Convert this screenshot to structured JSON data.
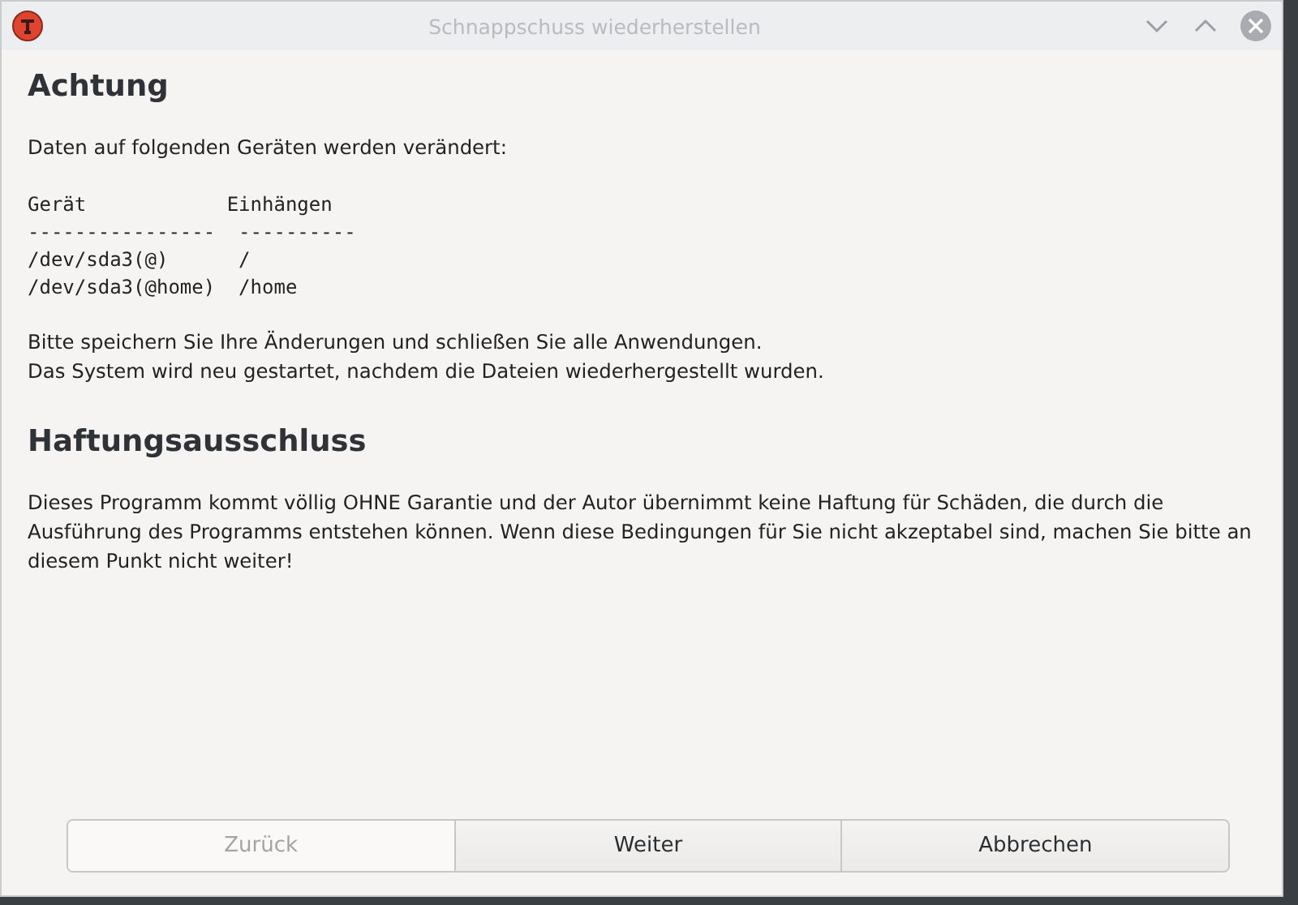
{
  "window": {
    "title": "Schnappschuss wiederherstellen"
  },
  "sections": [
    {
      "heading": "Achtung",
      "blocks": [
        {
          "kind": "text",
          "lines": [
            "Daten auf folgenden Geräten werden verändert:"
          ]
        },
        {
          "kind": "mono",
          "lines": [
            "Gerät            Einhängen",
            "----------------  ----------",
            "/dev/sda3(@)      /",
            "/dev/sda3(@home)  /home"
          ]
        },
        {
          "kind": "text",
          "lines": [
            "Bitte speichern Sie Ihre Änderungen und schließen Sie alle Anwendungen.",
            "Das System wird neu gestartet, nachdem die Dateien wiederhergestellt wurden."
          ]
        }
      ]
    },
    {
      "heading": "Haftungsausschluss",
      "blocks": [
        {
          "kind": "text",
          "lines": [
            "Dieses Programm kommt völlig OHNE Garantie und der Autor übernimmt keine Haftung für Schäden, die durch die Ausführung des Programms entstehen können. Wenn diese Bedingungen für Sie nicht akzeptabel sind, machen Sie bitte an diesem Punkt nicht weiter!"
          ]
        }
      ]
    }
  ],
  "buttons": [
    {
      "label": "Zurück",
      "disabled": true
    },
    {
      "label": "Weiter",
      "disabled": false
    },
    {
      "label": "Abbrechen",
      "disabled": false
    }
  ]
}
